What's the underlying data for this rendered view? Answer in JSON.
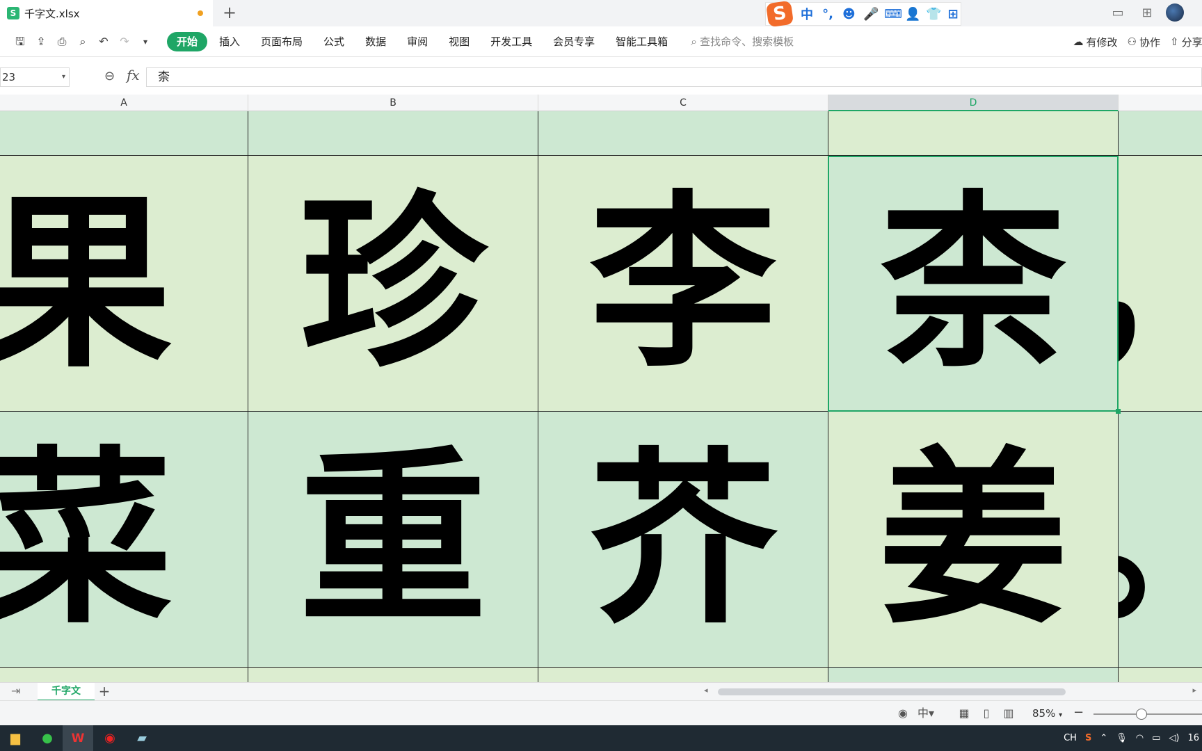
{
  "title_bar": {
    "doc_title": "千字文.xlsx",
    "new_tab_icon": "plus-icon",
    "ime_logo": "S",
    "ime_items": [
      "中",
      "°,",
      "☻",
      "🎤",
      "⌨",
      "👤",
      "👕",
      "⊞"
    ]
  },
  "ribbon": {
    "quick_tools": [
      "save-icon",
      "export-icon",
      "print-icon",
      "preview-icon",
      "undo-icon",
      "redo-icon",
      "more-icon"
    ],
    "menu": [
      {
        "label": "开始",
        "active": true
      },
      {
        "label": "插入"
      },
      {
        "label": "页面布局"
      },
      {
        "label": "公式"
      },
      {
        "label": "数据"
      },
      {
        "label": "审阅"
      },
      {
        "label": "视图"
      },
      {
        "label": "开发工具"
      },
      {
        "label": "会员专享"
      },
      {
        "label": "智能工具箱"
      }
    ],
    "search_placeholder": "查找命令、搜索模板",
    "modified_label": "有修改",
    "collab_label": "协作",
    "share_label": "分享"
  },
  "formula_bar": {
    "name_box": "23",
    "fx_label": "fx",
    "value": "柰"
  },
  "sheet": {
    "columns": [
      "A",
      "B",
      "C",
      "D"
    ],
    "selected_column": "D",
    "rows": [
      [
        "",
        "",
        "",
        "",
        ""
      ],
      [
        "果",
        "珍",
        "李",
        "柰",
        "，"
      ],
      [
        "菜",
        "重",
        "芥",
        "姜",
        "。"
      ]
    ],
    "selected_cell": "D"
  },
  "sheet_tabs": {
    "active": "千字文",
    "add_icon": "plus-icon"
  },
  "status_bar": {
    "zoom": "85%",
    "zoom_level": 0.85
  },
  "taskbar": {
    "apps": [
      "file-explorer-icon",
      "wechat-icon",
      "wps-icon",
      "recorder-icon",
      "notes-icon"
    ],
    "tray_lang": "CH",
    "clock": "16"
  },
  "colors": {
    "accent": "#1fa666",
    "cell_green_a": "#cde8d2",
    "cell_green_b": "#dcedd0"
  }
}
